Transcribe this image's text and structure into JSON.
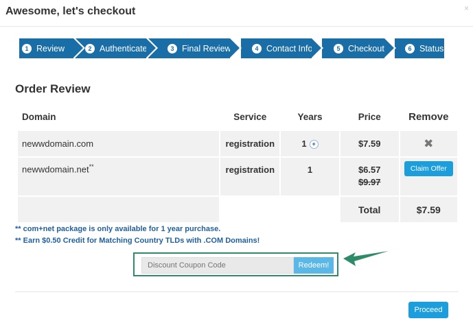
{
  "modal": {
    "title": "Awesome, let's checkout",
    "close": "×"
  },
  "steps": [
    {
      "num": "1",
      "label": "Review"
    },
    {
      "num": "2",
      "label": "Authenticate"
    },
    {
      "num": "3",
      "label": "Final Review"
    },
    {
      "num": "4",
      "label": "Contact Info"
    },
    {
      "num": "5",
      "label": "Checkout"
    },
    {
      "num": "6",
      "label": "Status"
    }
  ],
  "order": {
    "heading": "Order Review",
    "headers": {
      "domain": "Domain",
      "service": "Service",
      "years": "Years",
      "price": "Price",
      "remove": "Remove"
    },
    "rows": [
      {
        "domain": "newwdomain.com",
        "service": "registration",
        "years": "1",
        "price": "$7.59"
      },
      {
        "domain": "newwdomain.net",
        "domain_sup": "**",
        "service": "registration",
        "years": "1",
        "price": "$6.57",
        "old_price": "$9.97",
        "action": "Claim Offer"
      }
    ],
    "total_label": "Total",
    "total_value": "$7.59"
  },
  "notes": [
    "** com+net package is only available for 1 year purchase.",
    "** Earn $0.50 Credit for Matching Country TLDs with .COM Domains!"
  ],
  "coupon": {
    "placeholder": "Discount Coupon Code",
    "redeem": "Redeem!"
  },
  "proceed": "Proceed",
  "colors": {
    "step_bg": "#1a6ea8",
    "button": "#1b9edb",
    "highlight": "#2e8b69",
    "note": "#1f5f9e"
  }
}
